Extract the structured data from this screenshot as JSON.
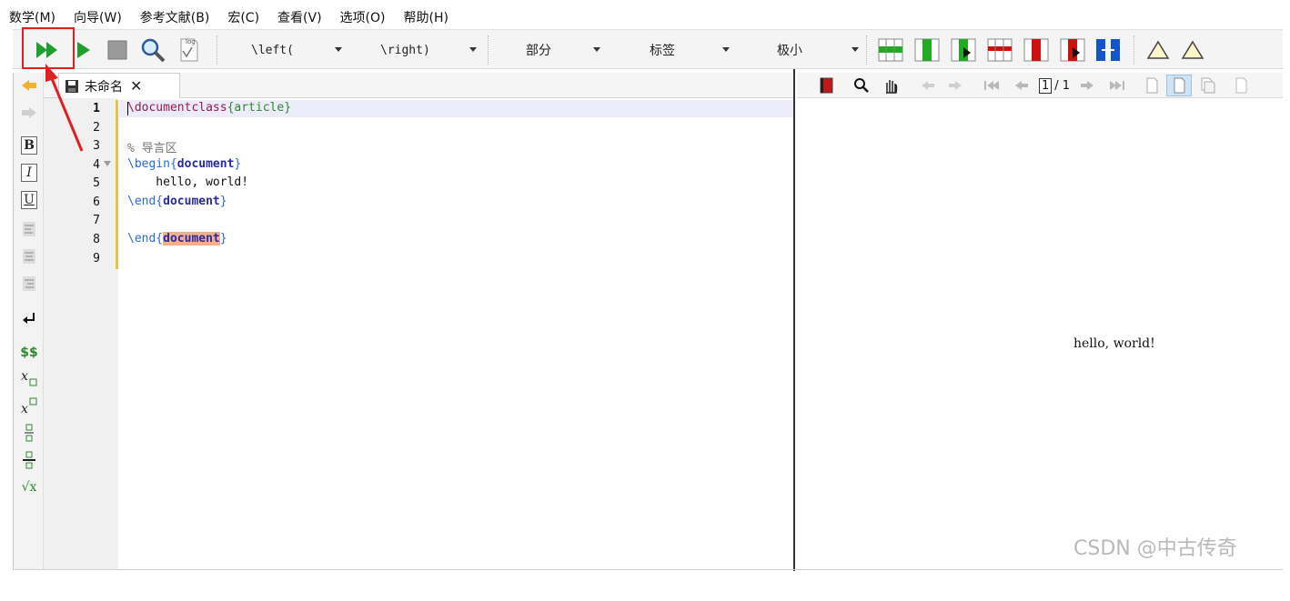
{
  "menu": [
    "数学(M)",
    "向导(W)",
    "参考文献(B)",
    "宏(C)",
    "查看(V)",
    "选项(O)",
    "帮助(H)"
  ],
  "toolbar": {
    "combos": [
      {
        "name": "left-delim-select",
        "value": "\\left("
      },
      {
        "name": "right-delim-select",
        "value": "\\right)"
      },
      {
        "name": "section-select",
        "value": "部分"
      },
      {
        "name": "label-select",
        "value": "标签"
      },
      {
        "name": "size-select",
        "value": "极小"
      }
    ],
    "log_icon_label": "log"
  },
  "colors": {
    "run_green": "#1f9f2f",
    "accent_red": "#e02020",
    "table_green": "#22aa22",
    "table_red": "#cc1111",
    "table_blue": "#1155cc"
  },
  "left_toolbar": {
    "bold": "B",
    "italic": "I",
    "underline": "U",
    "dollar": "$$",
    "sqrt": "√x"
  },
  "tab": {
    "label": "未命名",
    "close": "✕"
  },
  "editor": {
    "line_numbers": [
      "1",
      "2",
      "3",
      "4",
      "5",
      "6",
      "7",
      "8",
      "9"
    ],
    "lines": {
      "l1_cmd": "\\documentclass",
      "l1_open": "{",
      "l1_arg": "article",
      "l1_close": "}",
      "l3": "% 导言区",
      "l4_cmd": "\\begin{",
      "l4_arg": "document",
      "l4_close": "}",
      "l5": "    hello, world!",
      "l6_cmd": "\\end{",
      "l6_arg": "document",
      "l6_close": "}",
      "l8_cmd": "\\end{",
      "l8_arg": "document",
      "l8_close": "}"
    }
  },
  "viewer": {
    "page_current": "1",
    "page_total": "/ 1",
    "preview_text": "hello, world!"
  },
  "watermark": "CSDN @中古传奇"
}
